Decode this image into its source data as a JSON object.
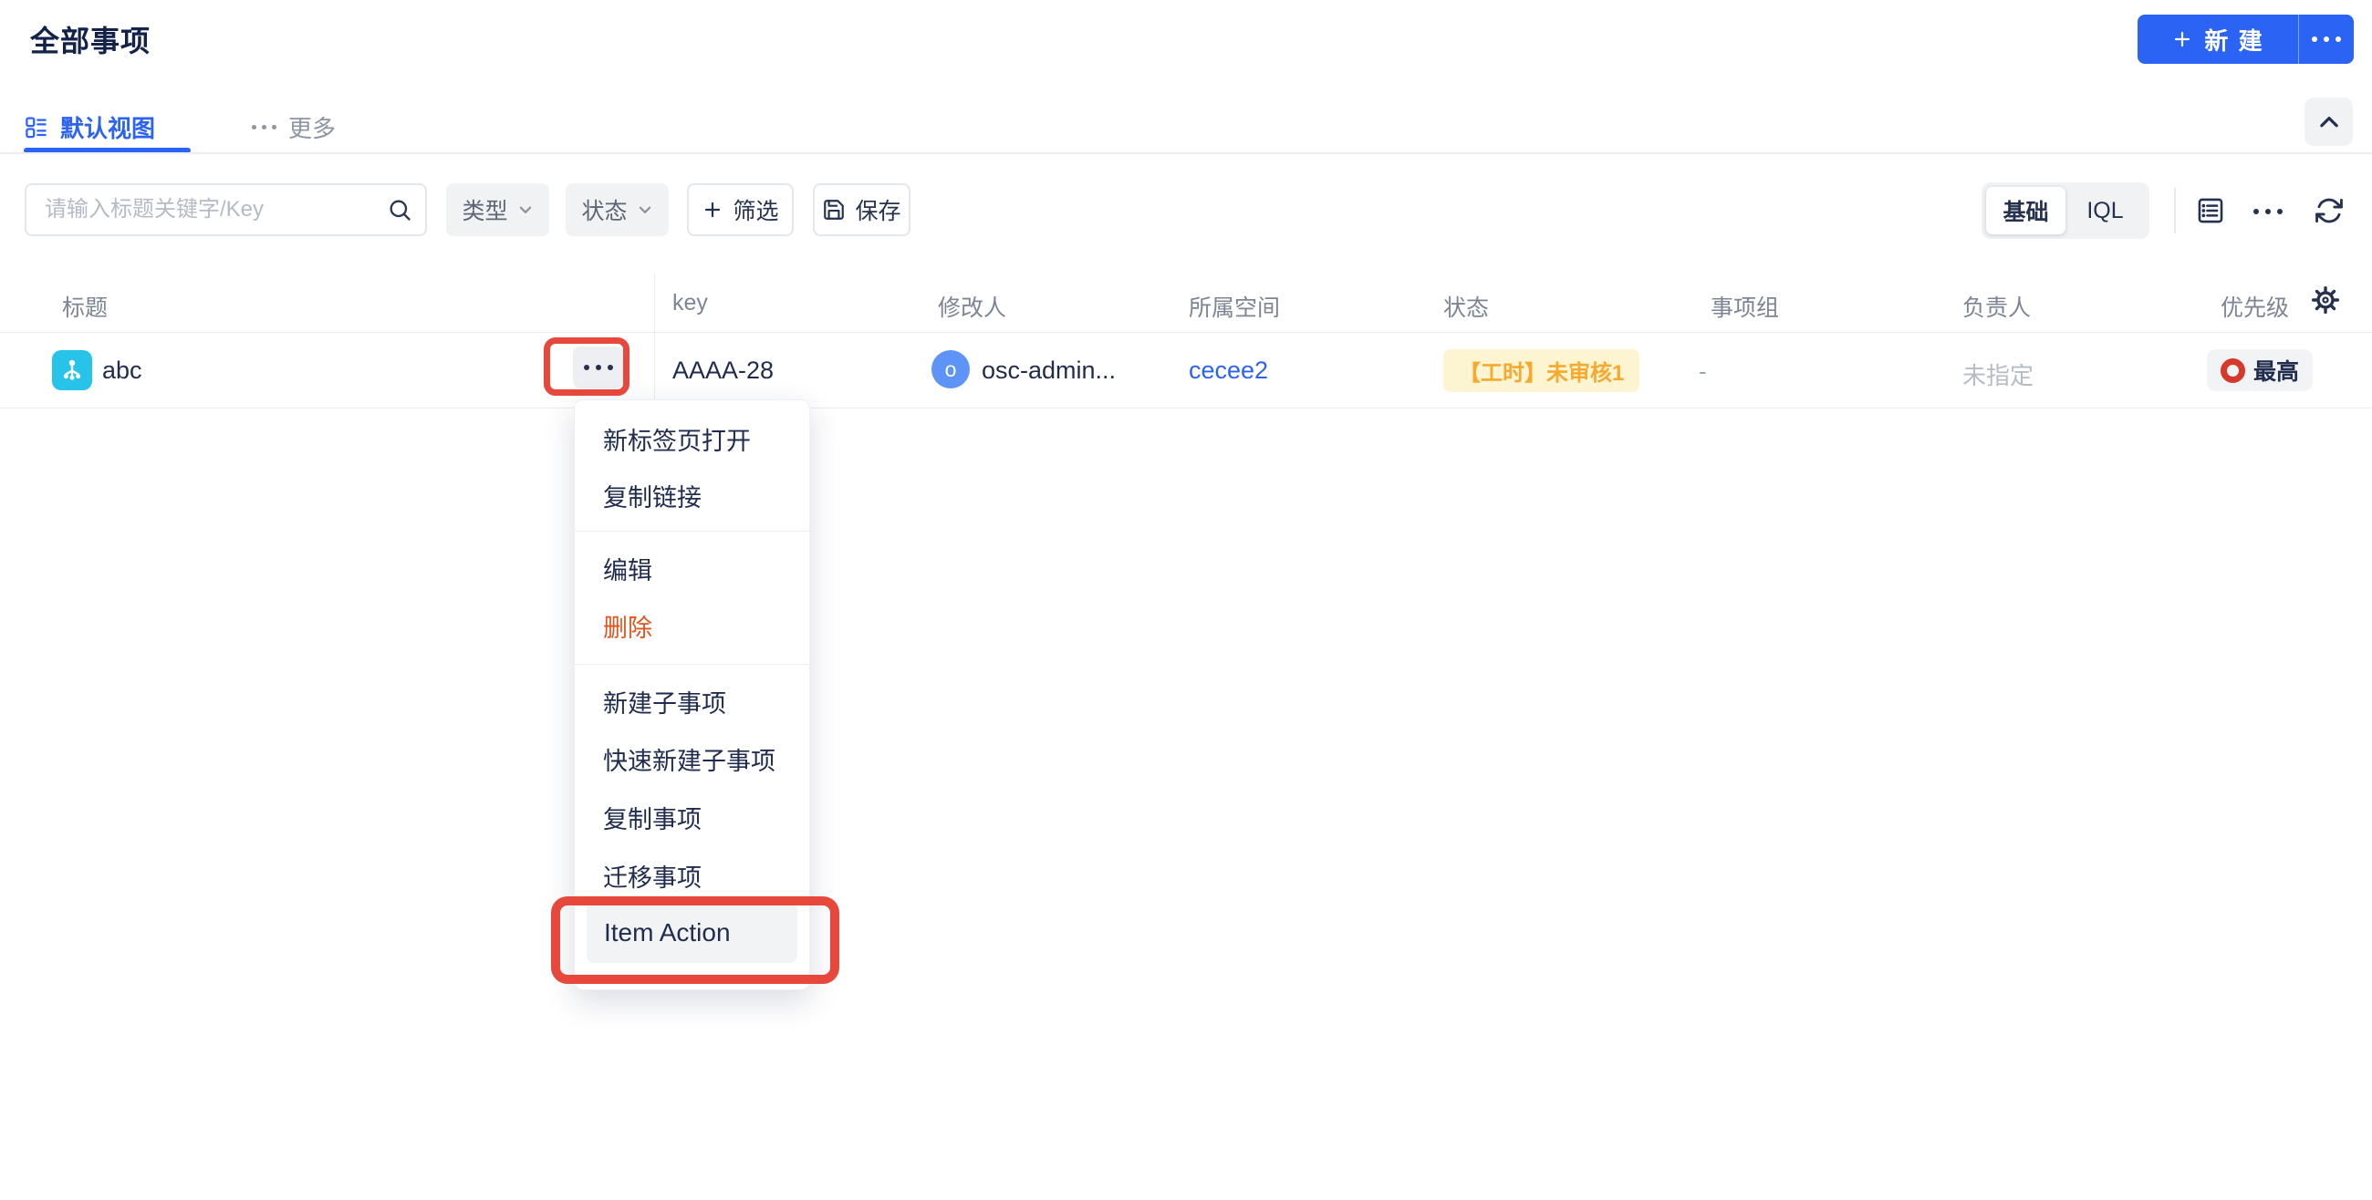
{
  "page": {
    "title": "全部事项"
  },
  "header": {
    "new_button": {
      "label": "新 建",
      "more_icon": "ellipsis"
    }
  },
  "tabs": {
    "default_view": "默认视图",
    "more": "更多"
  },
  "filter_bar": {
    "search_placeholder": "请输入标题关键字/Key",
    "search_value": "",
    "type_dropdown": "类型",
    "status_dropdown": "状态",
    "add_filter": "筛选",
    "save": "保存",
    "mode_toggle": {
      "basic": "基础",
      "iql": "IQL",
      "active": "基础"
    }
  },
  "table": {
    "columns": [
      "标题",
      "key",
      "修改人",
      "所属空间",
      "状态",
      "事项组",
      "负责人",
      "优先级"
    ],
    "rows": [
      {
        "title": "abc",
        "key": "AAAA-28",
        "modifier": "osc-admin...",
        "modifier_avatar_letter": "o",
        "space": "cecee2",
        "status": "【工时】未审核1",
        "item_group": "-",
        "assignee": "未指定",
        "priority": "最高"
      }
    ]
  },
  "context_menu": {
    "items": [
      "新标签页打开",
      "复制链接",
      "编辑",
      "删除",
      "新建子事项",
      "快速新建子事项",
      "复制事项",
      "迁移事项",
      "Item Action"
    ]
  },
  "colors": {
    "accent_blue": "#2b63f5",
    "danger_orange": "#e3541c",
    "annotation_red": "#e8473c",
    "status_badge_bg": "#fdf4d2",
    "status_badge_text": "#f7a92d",
    "priority_red": "#d5392c",
    "item_icon_teal": "#27c3e8",
    "avatar_blue": "#5e94f8",
    "text_navy": "#1f2c4e"
  }
}
